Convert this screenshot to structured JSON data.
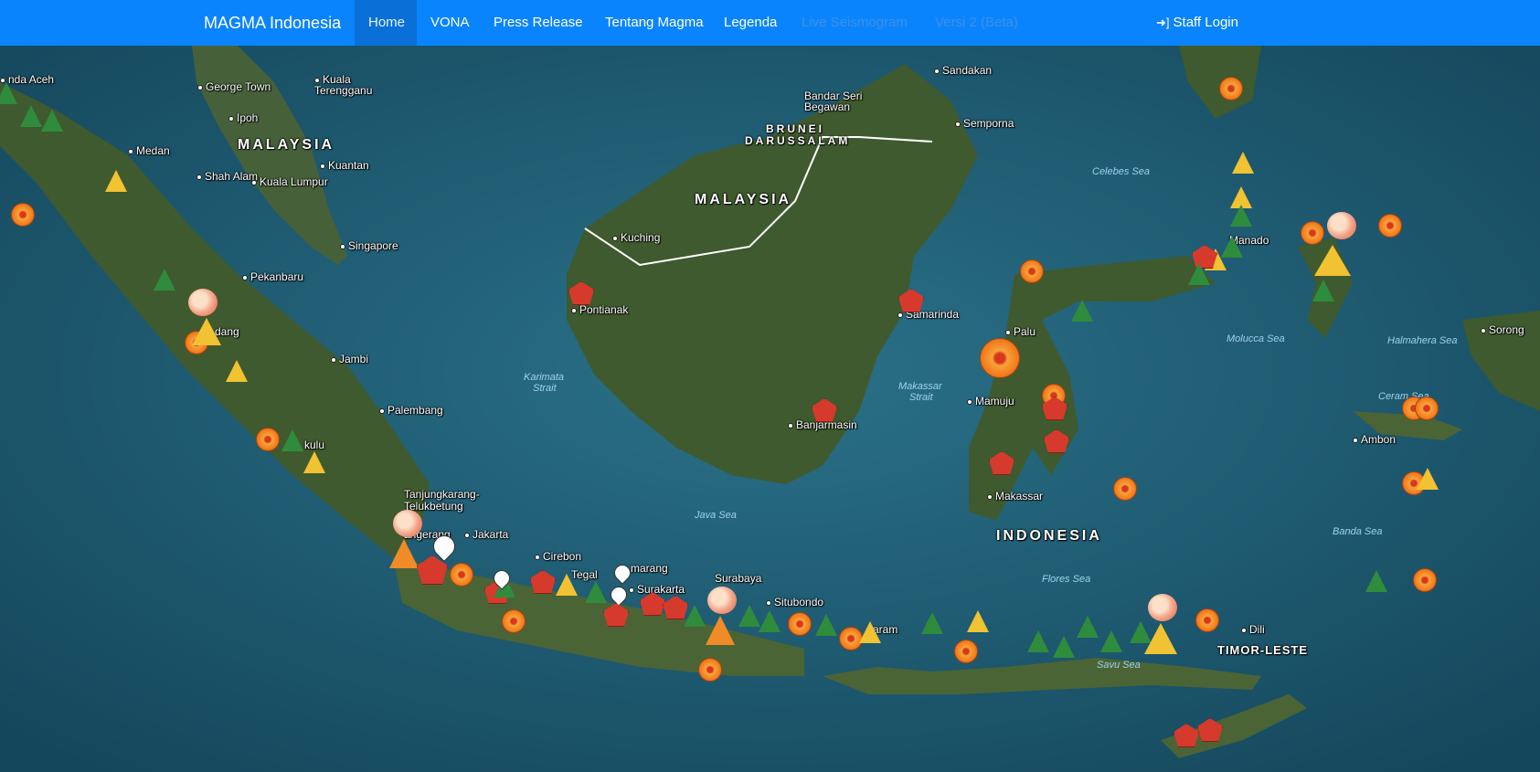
{
  "navbar": {
    "brand": "MAGMA Indonesia",
    "items": [
      {
        "label": "Home",
        "active": true
      },
      {
        "label": "VONA"
      },
      {
        "label": "Press Release"
      },
      {
        "label": "Tentang Magma"
      },
      {
        "label": "Legenda"
      },
      {
        "label": "Live Seismogram",
        "faded": true
      },
      {
        "label": "Versi 2 (Beta)",
        "faded": true
      }
    ],
    "login_icon": "sign-in-icon",
    "login_label": "Staff Login"
  },
  "map": {
    "countries": [
      "MALAYSIA",
      "MALAYSIA",
      "BRUNEI",
      "DARUSSALAM",
      "INDONESIA",
      "TIMOR-LESTE"
    ],
    "cities": [
      "nda Aceh",
      "George Town",
      "Kuala",
      "Terengganu",
      "Ipoh",
      "Medan",
      "Shah Alam",
      "Kuala Lumpur",
      "Kuantan",
      "Singapore",
      "Pekanbaru",
      "dang",
      "Jambi",
      "Palembang",
      "kulu",
      "Tanjungkarang-",
      "Telukbetung",
      "angerang",
      "Jakarta",
      "Cirebon",
      "Tegal",
      "marang",
      "Surakarta",
      "Surabaya",
      "Situbondo",
      "aram",
      "Sandakan",
      "Bandar Seri",
      "Begawan",
      "Semporna",
      "Kuching",
      "Pontianak",
      "Samarinda",
      "Banjarmasin",
      "Palu",
      "Mamuju",
      "Makassar",
      "Manado",
      "Sorong",
      "Ambon",
      "Dili"
    ],
    "seas": [
      "Celebes Sea",
      "Karimata",
      "Strait",
      "Java Sea",
      "Makassar",
      "Strait",
      "Molucca Sea",
      "Halmahera Sea",
      "Ceram Sea",
      "Banda Sea",
      "Flores Sea",
      "Savu Sea"
    ]
  }
}
